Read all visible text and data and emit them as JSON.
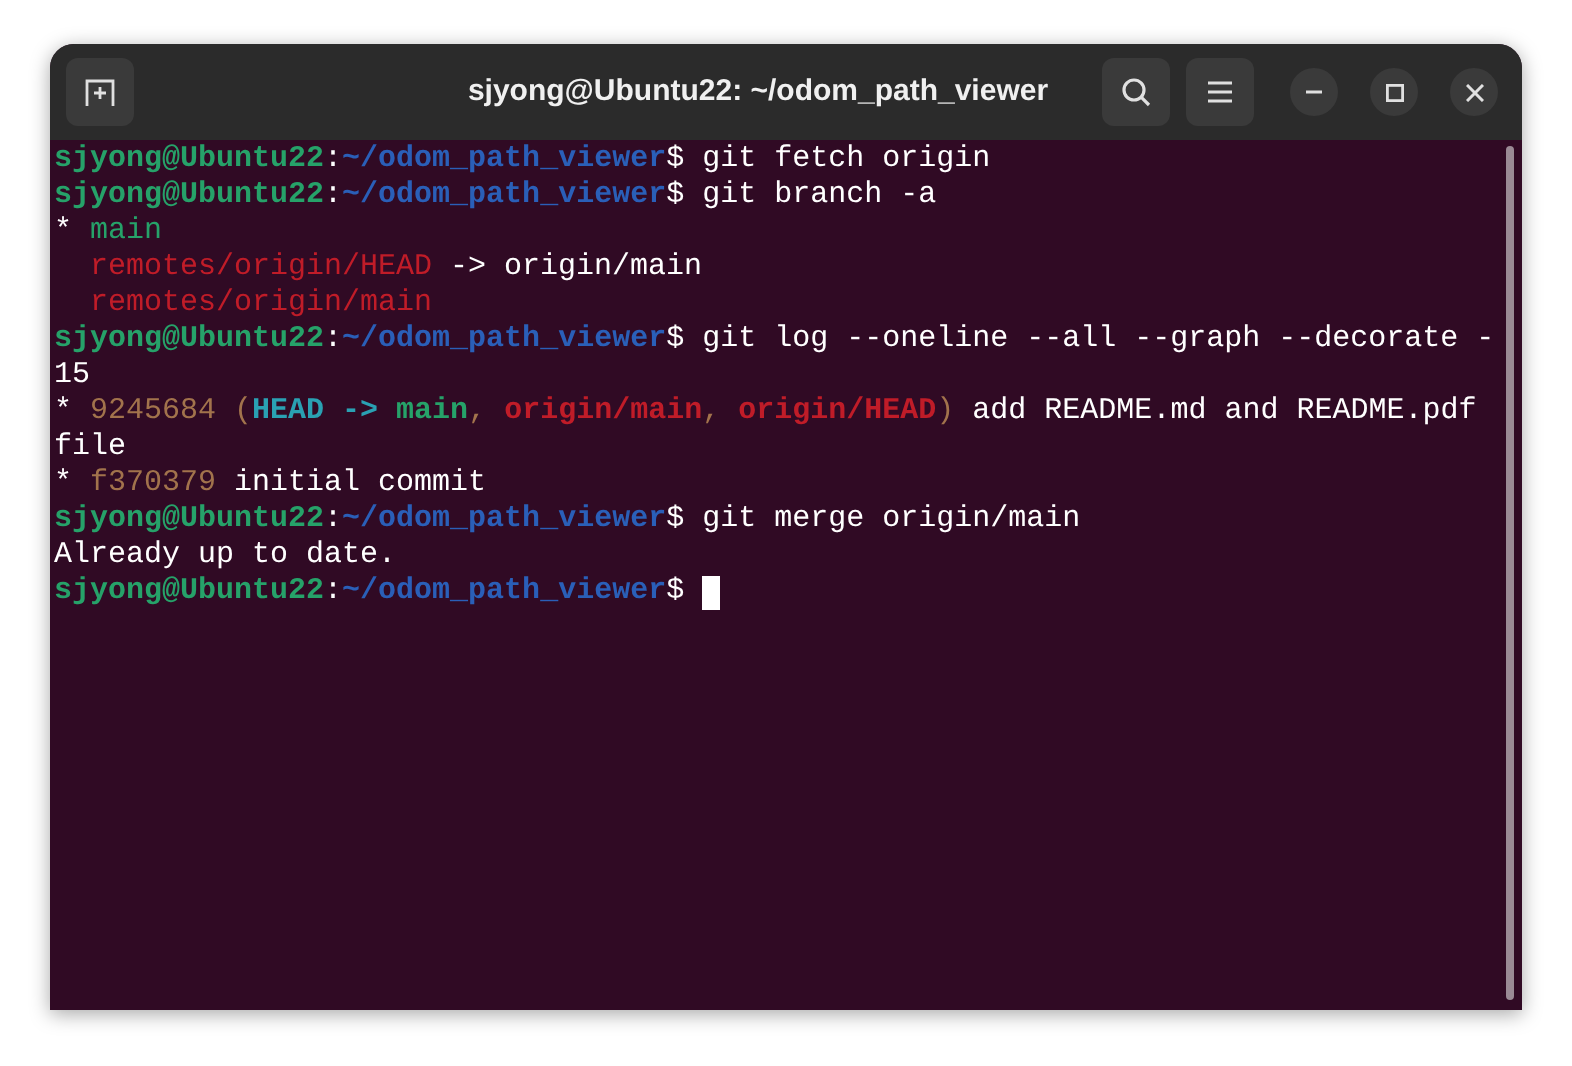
{
  "window": {
    "title": "sjyong@Ubuntu22: ~/odom_path_viewer"
  },
  "terminal": {
    "lines": [
      {
        "segments": [
          {
            "text": "sjyong@Ubuntu22",
            "color": "#26a269",
            "bold": true
          },
          {
            "text": ":",
            "color": "#ffffff",
            "bold": false
          },
          {
            "text": "~/odom_path_viewer",
            "color": "#2a5fb8",
            "bold": true
          },
          {
            "text": "$ git fetch origin",
            "color": "#ffffff",
            "bold": false
          }
        ]
      },
      {
        "segments": [
          {
            "text": "sjyong@Ubuntu22",
            "color": "#26a269",
            "bold": true
          },
          {
            "text": ":",
            "color": "#ffffff",
            "bold": false
          },
          {
            "text": "~/odom_path_viewer",
            "color": "#2a5fb8",
            "bold": true
          },
          {
            "text": "$ git branch -a",
            "color": "#ffffff",
            "bold": false
          }
        ]
      },
      {
        "segments": [
          {
            "text": "* ",
            "color": "#ffffff",
            "bold": false
          },
          {
            "text": "main",
            "color": "#26a269",
            "bold": false
          }
        ]
      },
      {
        "segments": [
          {
            "text": "  remotes/origin/HEAD",
            "color": "#c01c28",
            "bold": false
          },
          {
            "text": " -> origin/main",
            "color": "#ffffff",
            "bold": false
          }
        ]
      },
      {
        "segments": [
          {
            "text": "  remotes/origin/main",
            "color": "#c01c28",
            "bold": false
          }
        ]
      },
      {
        "segments": [
          {
            "text": "sjyong@Ubuntu22",
            "color": "#26a269",
            "bold": true
          },
          {
            "text": ":",
            "color": "#ffffff",
            "bold": false
          },
          {
            "text": "~/odom_path_viewer",
            "color": "#2a5fb8",
            "bold": true
          },
          {
            "text": "$ git log --oneline --all --graph --decorate -",
            "color": "#ffffff",
            "bold": false
          }
        ]
      },
      {
        "segments": [
          {
            "text": "15",
            "color": "#ffffff",
            "bold": false
          }
        ]
      },
      {
        "segments": [
          {
            "text": "* ",
            "color": "#ffffff",
            "bold": false
          },
          {
            "text": "9245684 (",
            "color": "#a2734c",
            "bold": false
          },
          {
            "text": "HEAD -> ",
            "color": "#2aa1b3",
            "bold": true
          },
          {
            "text": "main",
            "color": "#26a269",
            "bold": true
          },
          {
            "text": ", ",
            "color": "#a2734c",
            "bold": false
          },
          {
            "text": "origin/main",
            "color": "#c01c28",
            "bold": true
          },
          {
            "text": ", ",
            "color": "#a2734c",
            "bold": false
          },
          {
            "text": "origin/HEAD",
            "color": "#c01c28",
            "bold": true
          },
          {
            "text": ")",
            "color": "#a2734c",
            "bold": false
          },
          {
            "text": " add README.md and README.pdf",
            "color": "#ffffff",
            "bold": false
          }
        ]
      },
      {
        "segments": [
          {
            "text": "file",
            "color": "#ffffff",
            "bold": false
          }
        ]
      },
      {
        "segments": [
          {
            "text": "* ",
            "color": "#ffffff",
            "bold": false
          },
          {
            "text": "f370379",
            "color": "#a2734c",
            "bold": false
          },
          {
            "text": " initial commit",
            "color": "#ffffff",
            "bold": false
          }
        ]
      },
      {
        "segments": [
          {
            "text": "sjyong@Ubuntu22",
            "color": "#26a269",
            "bold": true
          },
          {
            "text": ":",
            "color": "#ffffff",
            "bold": false
          },
          {
            "text": "~/odom_path_viewer",
            "color": "#2a5fb8",
            "bold": true
          },
          {
            "text": "$ git merge origin/main",
            "color": "#ffffff",
            "bold": false
          }
        ]
      },
      {
        "segments": [
          {
            "text": "Already up to date.",
            "color": "#ffffff",
            "bold": false
          }
        ]
      },
      {
        "segments": [
          {
            "text": "sjyong@Ubuntu22",
            "color": "#26a269",
            "bold": true
          },
          {
            "text": ":",
            "color": "#ffffff",
            "bold": false
          },
          {
            "text": "~/odom_path_viewer",
            "color": "#2a5fb8",
            "bold": true
          },
          {
            "text": "$ ",
            "color": "#ffffff",
            "bold": false
          }
        ],
        "cursor": true
      }
    ]
  }
}
